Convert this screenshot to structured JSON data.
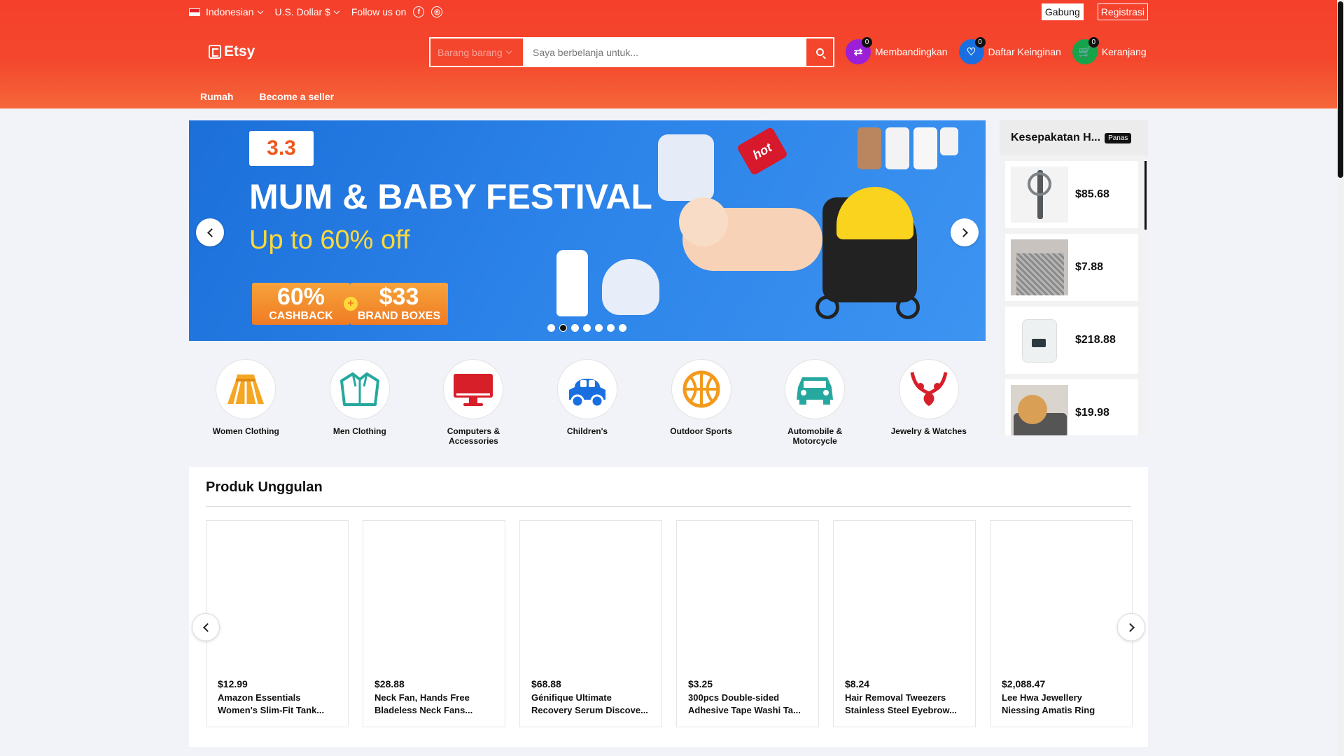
{
  "topbar": {
    "language": "Indonesian",
    "currency": "U.S. Dollar $",
    "follow_label": "Follow us on",
    "social_icons": [
      "facebook-icon",
      "instagram-icon"
    ],
    "join_label": "Gabung",
    "register_label": "Registrasi"
  },
  "brand": {
    "name": "Etsy"
  },
  "search": {
    "category_placeholder": "Barang barang",
    "placeholder": "Saya berbelanja untuk..."
  },
  "actions": [
    {
      "label": "Membandingkan",
      "count": "0",
      "icon": "compare-icon",
      "color": "#9b1fd6"
    },
    {
      "label": "Daftar Keinginan",
      "count": "0",
      "icon": "heart-icon",
      "color": "#1a6fe0"
    },
    {
      "label": "Keranjang",
      "count": "0",
      "icon": "cart-icon",
      "color": "#16a34a"
    }
  ],
  "nav": [
    "Rumah",
    "Become a seller"
  ],
  "banner": {
    "tag": "3.3",
    "title": "MUM & BABY FESTIVAL",
    "subtitle": "Up to 60% off",
    "cashback_big": "60%",
    "cashback_small": "CASHBACK",
    "brand_big": "$33",
    "brand_small": "BRAND BOXES",
    "hot_tag": "hot",
    "dot_count": 7,
    "active_dot": 2
  },
  "deals": {
    "title": "Kesepakatan H...",
    "badge": "Panas",
    "items": [
      {
        "price": "$85.68"
      },
      {
        "price": "$7.88"
      },
      {
        "price": "$218.88"
      },
      {
        "price": "$19.98"
      }
    ]
  },
  "categories": [
    {
      "name": "Women Clothing",
      "icon": "dress-icon",
      "color": "#f5a623"
    },
    {
      "name": "Men Clothing",
      "icon": "jacket-icon",
      "color": "#27a89e"
    },
    {
      "name": "Computers & Accessories",
      "icon": "monitor-icon",
      "color": "#d71f2a"
    },
    {
      "name": "Children's",
      "icon": "toy-car-icon",
      "color": "#1a6fe0"
    },
    {
      "name": "Outdoor Sports",
      "icon": "basketball-icon",
      "color": "#f39a1c"
    },
    {
      "name": "Automobile & Motorcycle",
      "icon": "car-icon",
      "color": "#27a89e"
    },
    {
      "name": "Jewelry & Watches",
      "icon": "necklace-icon",
      "color": "#d71f2a"
    }
  ],
  "featured": {
    "title": "Produk Unggulan",
    "products": [
      {
        "price": "$12.99",
        "line1": "Amazon Essentials",
        "line2": "Women's Slim-Fit Tank..."
      },
      {
        "price": "$28.88",
        "line1": "Neck Fan, Hands Free",
        "line2": "Bladeless Neck Fans..."
      },
      {
        "price": "$68.88",
        "line1": "Génifique Ultimate",
        "line2": "Recovery Serum Discove..."
      },
      {
        "price": "$3.25",
        "line1": "300pcs Double-sided",
        "line2": "Adhesive Tape Washi Ta..."
      },
      {
        "price": "$8.24",
        "line1": "Hair Removal Tweezers",
        "line2": "Stainless Steel Eyebrow..."
      },
      {
        "price": "$2,088.47",
        "line1": "Lee Hwa Jewellery",
        "line2": "Niessing Amatis Ring"
      }
    ]
  }
}
